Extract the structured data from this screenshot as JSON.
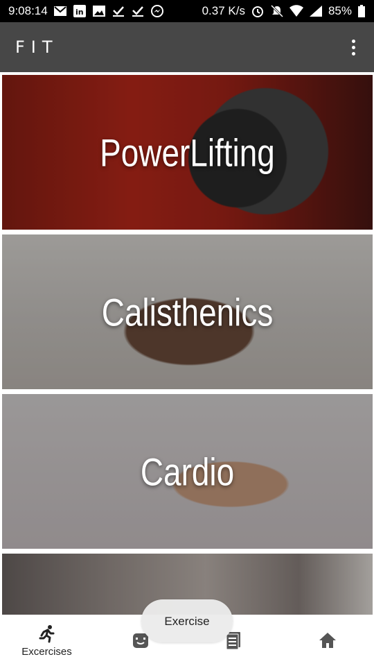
{
  "status_bar": {
    "time": "9:08:14",
    "speed": "0.37 K/s",
    "battery": "85%",
    "left_icons": [
      "gmail-icon",
      "linkedin-icon",
      "image-icon",
      "download-done-icon",
      "download-done-icon",
      "messenger-icon"
    ],
    "right_icons": [
      "alarm-icon",
      "mute-icon",
      "wifi-icon",
      "signal-icon",
      "battery-icon"
    ]
  },
  "app_bar": {
    "title": "FIT",
    "menu_icon": "more-vert-icon"
  },
  "categories": [
    {
      "label": "PowerLifting"
    },
    {
      "label": "Calisthenics"
    },
    {
      "label": "Cardio"
    },
    {
      "label": ""
    }
  ],
  "bottom_nav": {
    "items": [
      {
        "icon": "running-icon",
        "label": "Excercises",
        "active": true
      },
      {
        "icon": "diet-icon",
        "label": ""
      },
      {
        "icon": "list-icon",
        "label": ""
      },
      {
        "icon": "home-icon",
        "label": ""
      }
    ]
  },
  "toast": {
    "text": "Exercise"
  },
  "colors": {
    "app_bar": "#474747",
    "status_bar": "#000000",
    "nav_icon": "#555555"
  }
}
